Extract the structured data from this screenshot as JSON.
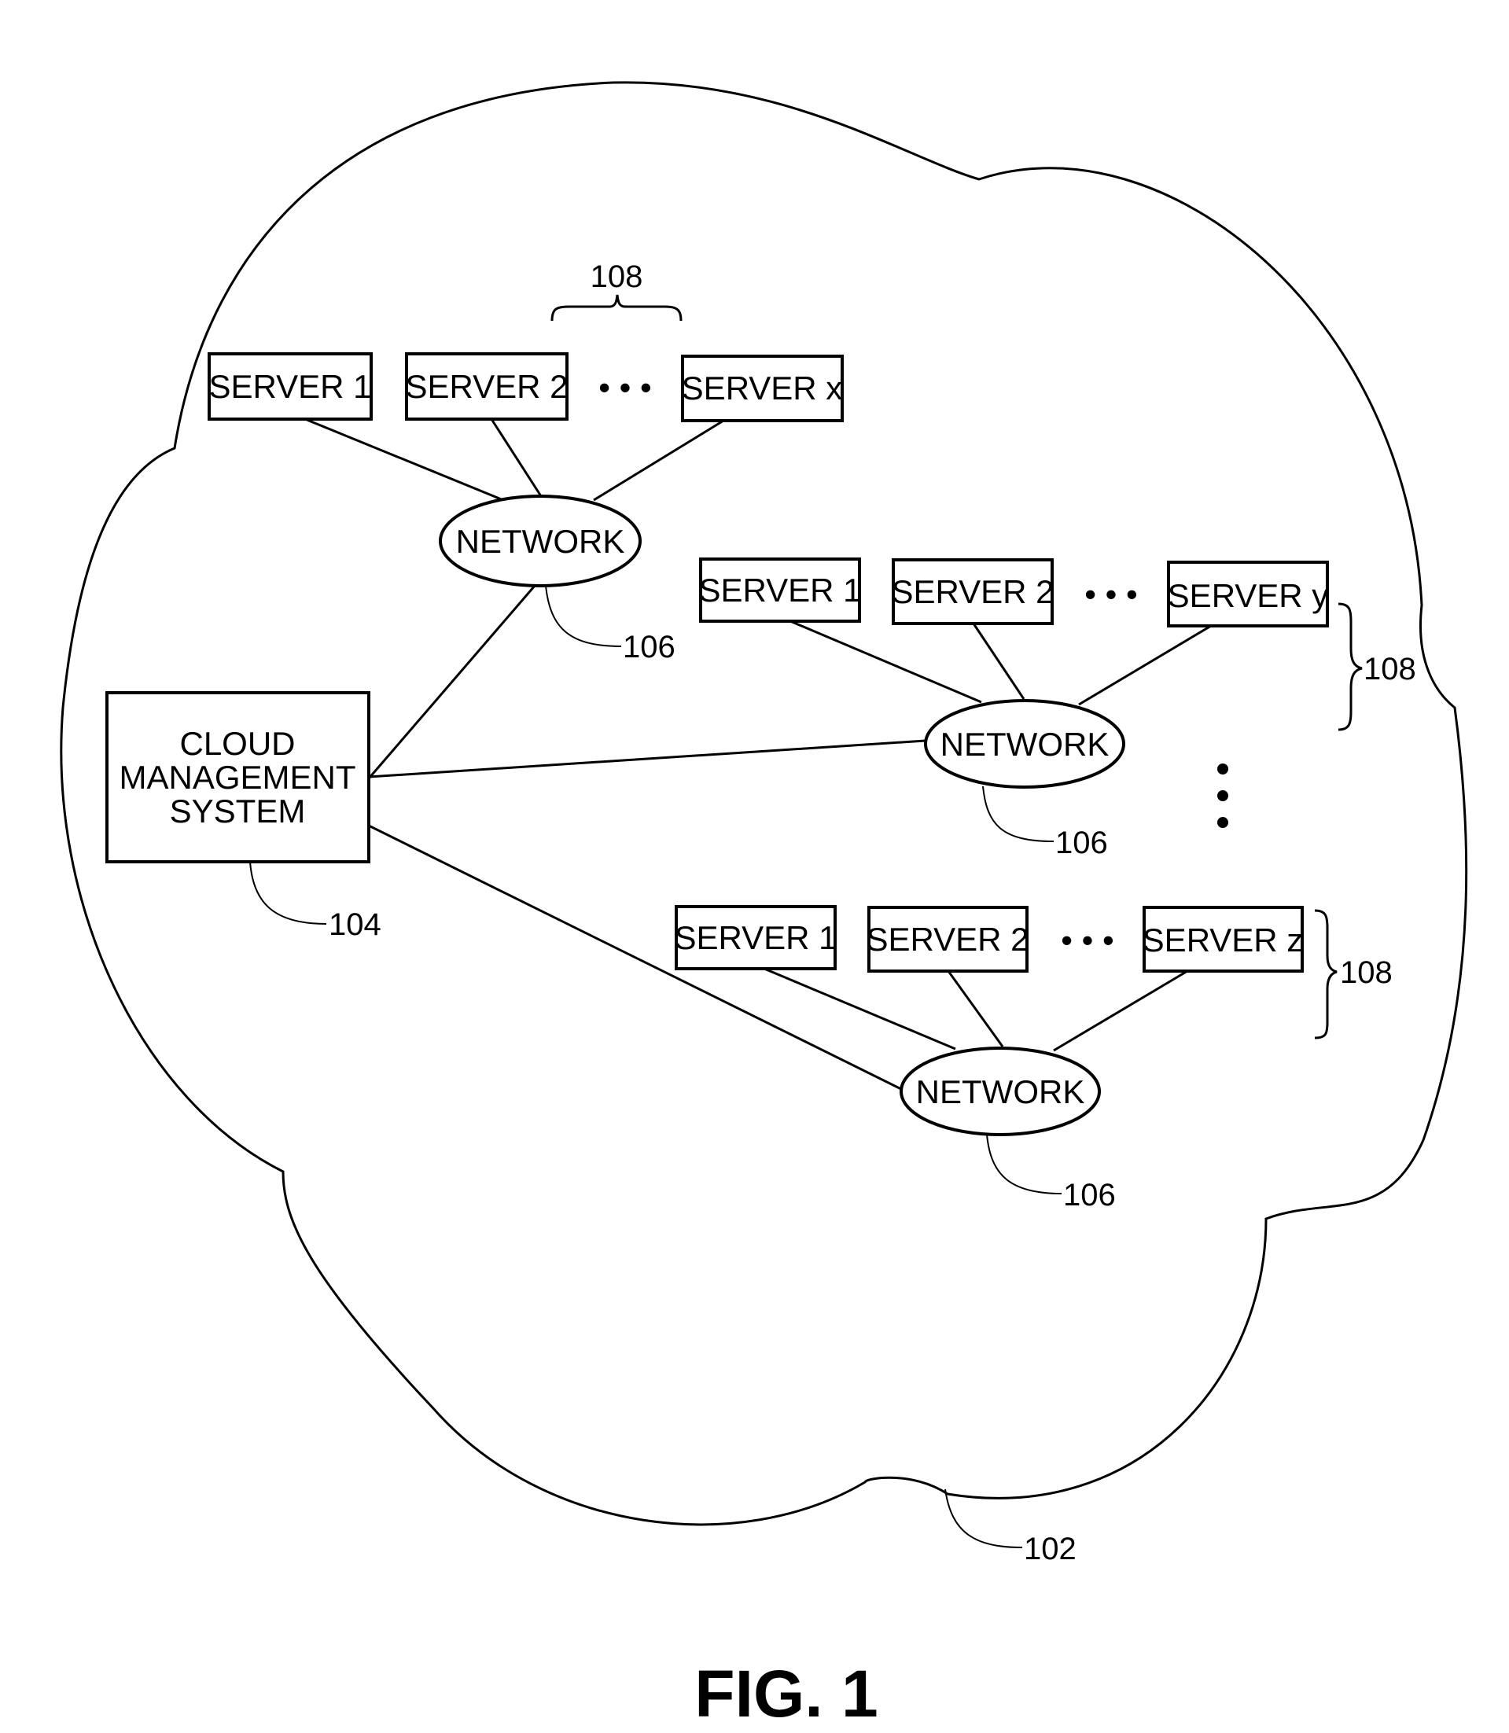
{
  "figure": {
    "caption": "FIG. 1",
    "cloud_ref": "102",
    "cms": {
      "lines": [
        "CLOUD",
        "MANAGEMENT",
        "SYSTEM"
      ],
      "ref": "104"
    },
    "network_label": "NETWORK",
    "network_ref": "106",
    "group_ref": "108",
    "ellipsis": "• • •",
    "clusters": [
      {
        "servers": [
          "SERVER 1",
          "SERVER 2",
          "SERVER x"
        ]
      },
      {
        "servers": [
          "SERVER 1",
          "SERVER 2",
          "SERVER y"
        ]
      },
      {
        "servers": [
          "SERVER 1",
          "SERVER 2",
          "SERVER z"
        ]
      }
    ]
  }
}
